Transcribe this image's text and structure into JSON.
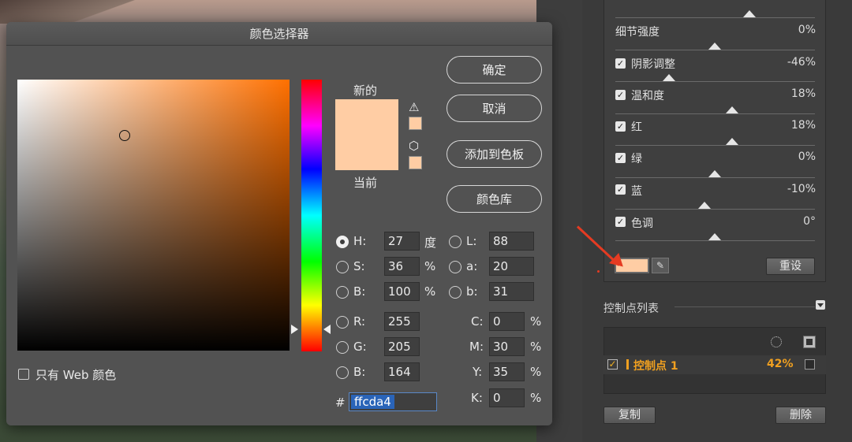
{
  "dialog": {
    "title": "颜色选择器",
    "new_label": "新的",
    "current_label": "当前",
    "web_only_label": "只有 Web 颜色",
    "swatch_color": "#ffcda4",
    "buttons": {
      "ok": "确定",
      "cancel": "取消",
      "add_to_swatches": "添加到色板",
      "color_libraries": "颜色库"
    },
    "hsb": {
      "h": {
        "label": "H:",
        "value": "27",
        "unit": "度"
      },
      "s": {
        "label": "S:",
        "value": "36",
        "unit": "%"
      },
      "b": {
        "label": "B:",
        "value": "100",
        "unit": "%"
      }
    },
    "rgb": {
      "r": {
        "label": "R:",
        "value": "255"
      },
      "g": {
        "label": "G:",
        "value": "205"
      },
      "b": {
        "label": "B:",
        "value": "164"
      }
    },
    "lab": {
      "l": {
        "label": "L:",
        "value": "88"
      },
      "a": {
        "label": "a:",
        "value": "20"
      },
      "b": {
        "label": "b:",
        "value": "31"
      }
    },
    "cmyk": {
      "c": {
        "label": "C:",
        "value": "0",
        "unit": "%"
      },
      "m": {
        "label": "M:",
        "value": "30",
        "unit": "%"
      },
      "y": {
        "label": "Y:",
        "value": "35",
        "unit": "%"
      },
      "k": {
        "label": "K:",
        "value": "0",
        "unit": "%"
      }
    },
    "hex": {
      "prefix": "#",
      "value": "ffcda4"
    },
    "icons": {
      "warning": "warning-icon",
      "cube": "cube-icon"
    }
  },
  "panel": {
    "rows": [
      {
        "label": "细节强度",
        "value": "0%",
        "checkbox": false
      },
      {
        "label": "阴影调整",
        "value": "-46%",
        "checkbox": true
      },
      {
        "label": "温和度",
        "value": "18%",
        "checkbox": true
      },
      {
        "label": "红",
        "value": "18%",
        "checkbox": true
      },
      {
        "label": "绿",
        "value": "0%",
        "checkbox": true
      },
      {
        "label": "蓝",
        "value": "-10%",
        "checkbox": true
      },
      {
        "label": "色调",
        "value": "0°",
        "checkbox": true
      }
    ],
    "reset_label": "重设",
    "control_points_title": "控制点列表",
    "control_point": {
      "name": "控制点 1",
      "value": "42%",
      "checked": true
    },
    "copy_label": "复制",
    "delete_label": "删除",
    "selected_color": "#ffcda4"
  }
}
